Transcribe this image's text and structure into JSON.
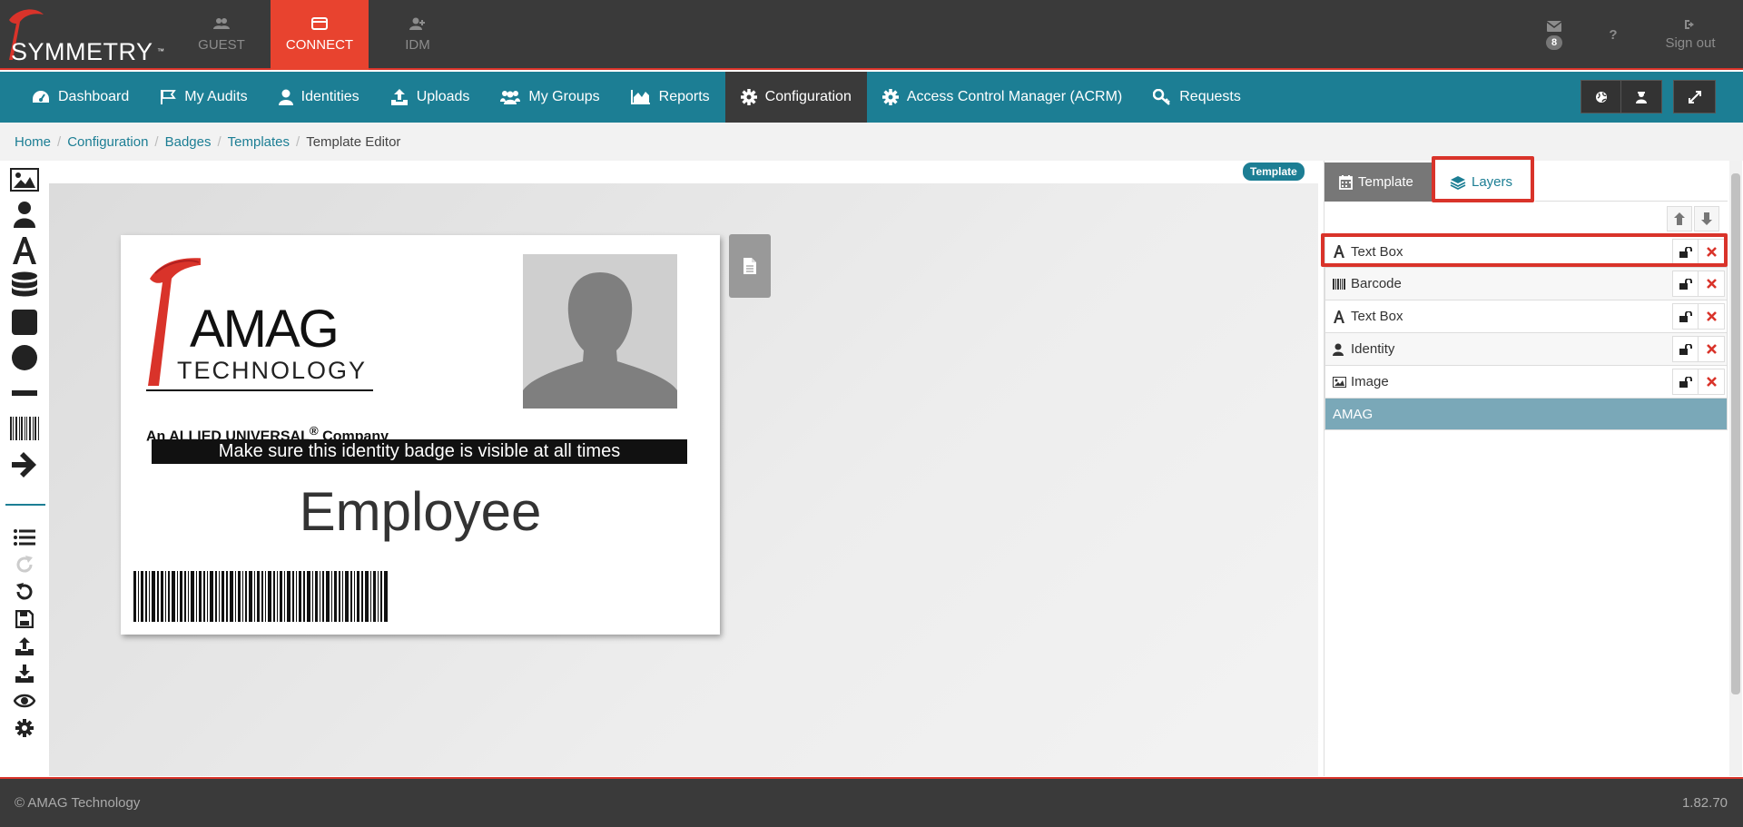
{
  "brand": {
    "name": "SYMMETRY",
    "tm": "™"
  },
  "topnav": [
    {
      "label": "GUEST",
      "icon": "users-icon"
    },
    {
      "label": "CONNECT",
      "icon": "card-icon",
      "active": true
    },
    {
      "label": "IDM",
      "icon": "user-plus-icon"
    }
  ],
  "topright": {
    "mail_count": "8",
    "help_label": "?",
    "signout_label": "Sign out"
  },
  "mainnav": [
    {
      "label": "Dashboard",
      "icon": "dashboard-icon"
    },
    {
      "label": "My Audits",
      "icon": "flag-icon"
    },
    {
      "label": "Identities",
      "icon": "user-icon"
    },
    {
      "label": "Uploads",
      "icon": "upload-icon"
    },
    {
      "label": "My Groups",
      "icon": "group-icon"
    },
    {
      "label": "Reports",
      "icon": "chart-icon"
    },
    {
      "label": "Configuration",
      "icon": "gear-icon",
      "active": true
    },
    {
      "label": "Access Control Manager (ACRM)",
      "icon": "gear-icon"
    },
    {
      "label": "Requests",
      "icon": "key-icon"
    }
  ],
  "breadcrumb": [
    "Home",
    "Configuration",
    "Badges",
    "Templates",
    "Template Editor"
  ],
  "editor": {
    "template_badge": "Template",
    "card": {
      "logo_word": "AMAG",
      "logo_sub": "TECHNOLOGY",
      "logo_company": "An ALLIED UNIVERSAL",
      "logo_reg": "®",
      "logo_company_tail": " Company",
      "banner_text": "Make sure this identity badge is visible at all times",
      "role_text": "Employee"
    }
  },
  "panel": {
    "tab_template": "Template",
    "tab_layers": "Layers",
    "layers": [
      {
        "label": "Text Box",
        "icon": "text-icon"
      },
      {
        "label": "Barcode",
        "icon": "barcode-icon"
      },
      {
        "label": "Text Box",
        "icon": "text-icon"
      },
      {
        "label": "Identity",
        "icon": "user-icon"
      },
      {
        "label": "Image",
        "icon": "image-icon"
      }
    ],
    "group_label": "AMAG"
  },
  "footer": {
    "copyright": "© AMAG Technology",
    "version": "1.82.70"
  },
  "colors": {
    "accent": "#1c7e94",
    "brand_red": "#e8432f",
    "dark": "#3a3a3a",
    "highlight": "#d9332a"
  }
}
